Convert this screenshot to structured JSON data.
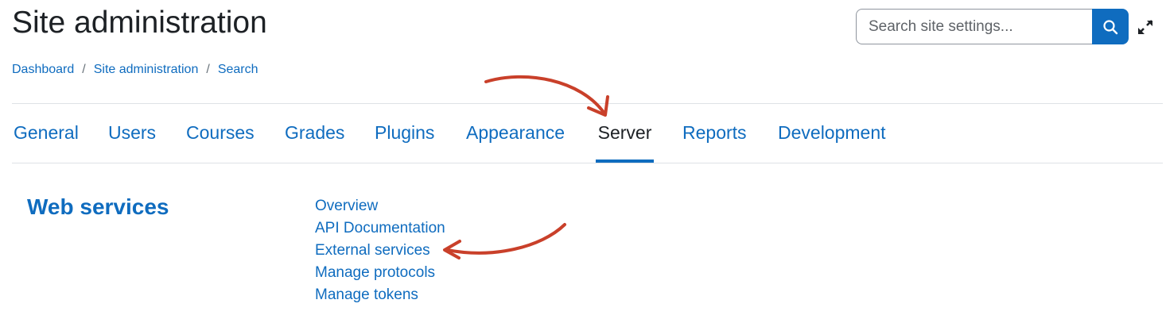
{
  "page": {
    "title": "Site administration"
  },
  "search": {
    "placeholder": "Search site settings...",
    "value": "",
    "button_icon": "search-icon"
  },
  "header": {
    "expand_icon": "expand-icon"
  },
  "breadcrumb": {
    "items": [
      "Dashboard",
      "Site administration",
      "Search"
    ],
    "separator": "/"
  },
  "tabs": {
    "items": [
      "General",
      "Users",
      "Courses",
      "Grades",
      "Plugins",
      "Appearance",
      "Server",
      "Reports",
      "Development"
    ],
    "active": "Server"
  },
  "section": {
    "title": "Web services",
    "links": [
      "Overview",
      "API Documentation",
      "External services",
      "Manage protocols",
      "Manage tokens"
    ]
  },
  "colors": {
    "accent": "#0f6cbf",
    "text": "#1d2125",
    "divider": "#dee2e6",
    "annotation_arrow": "#c9402a"
  }
}
